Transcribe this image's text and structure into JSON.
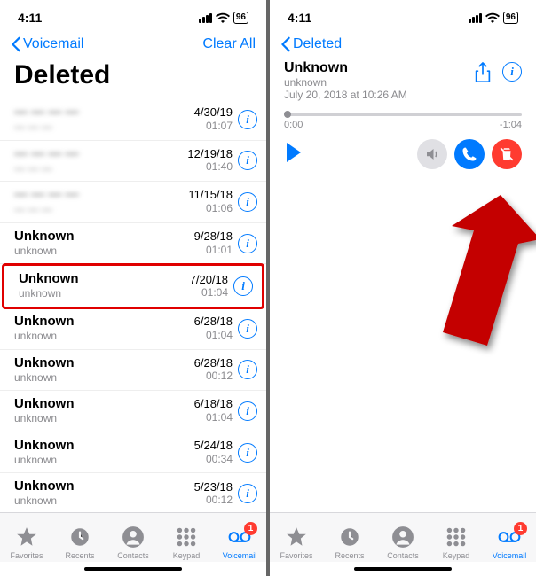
{
  "status": {
    "time": "4:11",
    "battery": "96"
  },
  "left": {
    "back": "Voicemail",
    "clear": "Clear All",
    "title": "Deleted",
    "items": [
      {
        "title": "— — — —",
        "sub": "— — —",
        "date": "4/30/19",
        "dur": "01:07",
        "blur": true
      },
      {
        "title": "— — — —",
        "sub": "— — —",
        "date": "12/19/18",
        "dur": "01:40",
        "blur": true
      },
      {
        "title": "— — — —",
        "sub": "— — —",
        "date": "11/15/18",
        "dur": "01:06",
        "blur": true
      },
      {
        "title": "Unknown",
        "sub": "unknown",
        "date": "9/28/18",
        "dur": "01:01"
      },
      {
        "title": "Unknown",
        "sub": "unknown",
        "date": "7/20/18",
        "dur": "01:04",
        "hl": true
      },
      {
        "title": "Unknown",
        "sub": "unknown",
        "date": "6/28/18",
        "dur": "01:04"
      },
      {
        "title": "Unknown",
        "sub": "unknown",
        "date": "6/28/18",
        "dur": "00:12"
      },
      {
        "title": "Unknown",
        "sub": "unknown",
        "date": "6/18/18",
        "dur": "01:04"
      },
      {
        "title": "Unknown",
        "sub": "unknown",
        "date": "5/24/18",
        "dur": "00:34"
      },
      {
        "title": "Unknown",
        "sub": "unknown",
        "date": "5/23/18",
        "dur": "00:12"
      }
    ]
  },
  "right": {
    "back": "Deleted",
    "detail": {
      "title": "Unknown",
      "sub": "unknown",
      "timestamp": "July 20, 2018 at 10:26 AM",
      "elapsed": "0:00",
      "remaining": "-1:04"
    }
  },
  "tabs": {
    "favorites": "Favorites",
    "recents": "Recents",
    "contacts": "Contacts",
    "keypad": "Keypad",
    "voicemail": "Voicemail",
    "badge": "1"
  }
}
